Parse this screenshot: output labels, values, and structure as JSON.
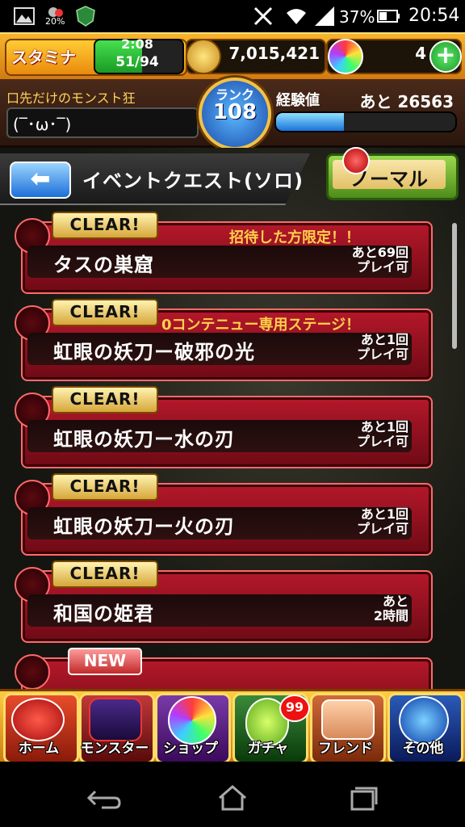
{
  "status_bar": {
    "battery": "37%",
    "time": "20:54",
    "temp_badge": "20%"
  },
  "header": {
    "stamina_label": "スタミナ",
    "stamina_timer": "2:08",
    "stamina_count": "51/94",
    "stamina_fraction": 0.54,
    "gold": "7,015,421",
    "orbs": "4",
    "plus_symbol": "+"
  },
  "profile": {
    "username": "口先だけのモンスト狂",
    "comment": "(‾･ω･‾)",
    "rank_label": "ランク",
    "rank_value": "108",
    "exp_label": "経験値",
    "exp_remaining": "あと 26563",
    "exp_fraction": 0.38
  },
  "page": {
    "back_label": "⬅",
    "title": "イベントクエスト(ソロ)",
    "difficulty": "ノーマル"
  },
  "quests": [
    {
      "badge": "CLEAR!",
      "note": "招待した方限定！！",
      "name": "タスの巣窟",
      "remain_1": "あと69回",
      "remain_2": "プレイ可"
    },
    {
      "badge": "CLEAR!",
      "note": "0コンテニュー専用ステージ！",
      "name": "虹眼の妖刀ー破邪の光",
      "remain_1": "あと1回",
      "remain_2": "プレイ可"
    },
    {
      "badge": "CLEAR!",
      "note": "",
      "name": "虹眼の妖刀ー水の刃",
      "remain_1": "あと1回",
      "remain_2": "プレイ可"
    },
    {
      "badge": "CLEAR!",
      "note": "",
      "name": "虹眼の妖刀ー火の刃",
      "remain_1": "あと1回",
      "remain_2": "プレイ可"
    },
    {
      "badge": "CLEAR!",
      "note": "",
      "name": "和国の姫君",
      "remain_1": "あと",
      "remain_2": "2時間"
    },
    {
      "badge": "NEW",
      "note": "",
      "name": "",
      "remain_1": "",
      "remain_2": ""
    }
  ],
  "bottom_nav": [
    {
      "label": "ホーム",
      "icon": "home-monster-icon"
    },
    {
      "label": "モンスター",
      "icon": "monster-icon"
    },
    {
      "label": "ショップ",
      "icon": "orb-shop-icon"
    },
    {
      "label": "ガチャ",
      "icon": "gacha-egg-icon",
      "badge": "99"
    },
    {
      "label": "フレンド",
      "icon": "handshake-icon"
    },
    {
      "label": "その他",
      "icon": "globe-icon"
    }
  ],
  "colors": {
    "accent_gold": "#f7b52b",
    "card_red": "#b5182a",
    "clear_badge": "#fff3b0"
  }
}
